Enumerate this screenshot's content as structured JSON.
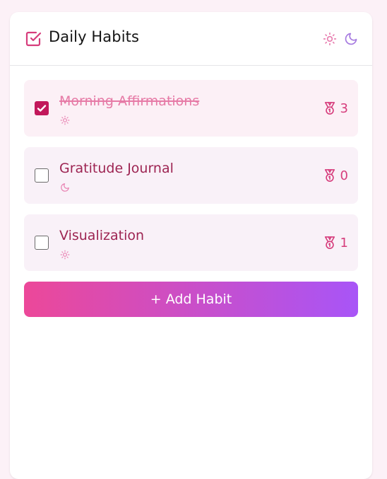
{
  "header": {
    "title": "Daily Habits",
    "title_icon": "check-square-icon",
    "mode_icons": [
      "sun-icon",
      "moon-icon"
    ]
  },
  "colors": {
    "accent": "#c2185b",
    "habit_text": "#9d2452",
    "completed_text": "#e67aa6",
    "gradient_start": "#ec4899",
    "gradient_end": "#a855f7"
  },
  "habits": [
    {
      "name": "Morning Affirmations",
      "completed": true,
      "time_icon": "sun-icon",
      "streak": "3"
    },
    {
      "name": "Gratitude Journal",
      "completed": false,
      "time_icon": "moon-icon",
      "streak": "0"
    },
    {
      "name": "Visualization",
      "completed": false,
      "time_icon": "sun-icon",
      "streak": "1"
    }
  ],
  "add_button": {
    "label": "+ Add Habit"
  }
}
